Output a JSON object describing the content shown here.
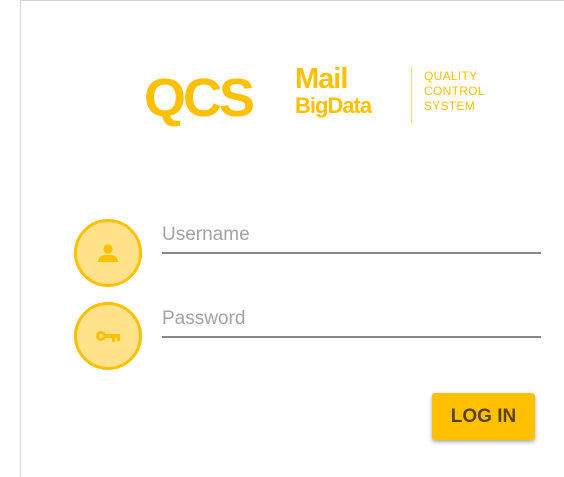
{
  "logo": {
    "qcs": "QCS",
    "mail": "Mail",
    "bigdata": "BigData",
    "tagline": [
      "QUALITY",
      "CONTROL",
      "SYSTEM"
    ]
  },
  "login": {
    "username_placeholder": "Username",
    "username_value": "",
    "password_placeholder": "Password",
    "password_value": "",
    "submit_label": "LOG IN"
  },
  "icons": {
    "username": "user-icon",
    "password": "key-icon"
  },
  "colors": {
    "accent": "#ffc000",
    "accent_light": "#ffe28a",
    "underline": "#8a8a8a",
    "placeholder": "#a3a3a3"
  }
}
